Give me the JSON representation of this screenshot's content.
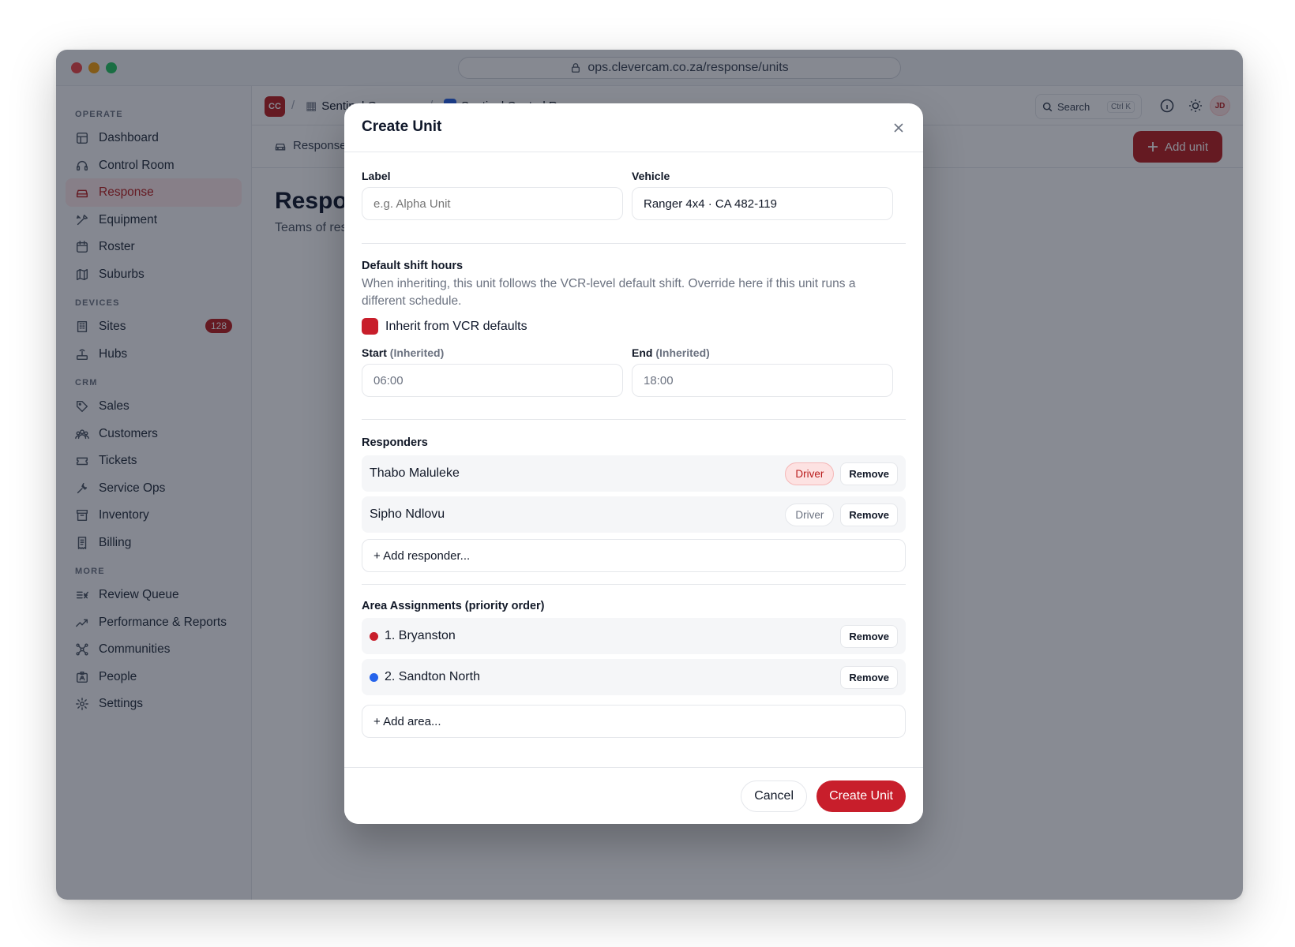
{
  "browser": {
    "url": "ops.clevercam.co.za/response/units"
  },
  "sidebar": {
    "sections": [
      {
        "label": "OPERATE",
        "items": [
          {
            "label": "Dashboard",
            "icon": "dashboard-icon"
          },
          {
            "label": "Control Room",
            "icon": "headset-icon"
          },
          {
            "label": "Response",
            "icon": "car-icon",
            "active": true
          },
          {
            "label": "Equipment",
            "icon": "tools-icon"
          },
          {
            "label": "Roster",
            "icon": "calendar-icon"
          },
          {
            "label": "Suburbs",
            "icon": "map-icon"
          }
        ]
      },
      {
        "label": "DEVICES",
        "items": [
          {
            "label": "Sites",
            "icon": "building-icon",
            "badge": "128"
          },
          {
            "label": "Hubs",
            "icon": "router-icon"
          }
        ]
      },
      {
        "label": "CRM",
        "items": [
          {
            "label": "Sales",
            "icon": "tag-icon"
          },
          {
            "label": "Customers",
            "icon": "users-icon"
          },
          {
            "label": "Tickets",
            "icon": "ticket-icon"
          },
          {
            "label": "Service Ops",
            "icon": "wrench-icon"
          },
          {
            "label": "Inventory",
            "icon": "archive-icon"
          },
          {
            "label": "Billing",
            "icon": "receipt-icon"
          }
        ]
      },
      {
        "label": "MORE",
        "items": [
          {
            "label": "Review Queue",
            "icon": "list-check-icon"
          },
          {
            "label": "Performance & Reports",
            "icon": "chart-line-icon"
          },
          {
            "label": "Communities",
            "icon": "network-icon"
          },
          {
            "label": "People",
            "icon": "id-card-icon"
          },
          {
            "label": "Settings",
            "icon": "gear-icon"
          }
        ]
      }
    ]
  },
  "topbar": {
    "org_initials": "CC",
    "crumb_group": "Sentinel Group",
    "crumb_room": "Sentinel Control Room",
    "search_label": "Search",
    "search_kbd": "Ctrl K",
    "user_initials": "JD"
  },
  "subbar": {
    "tab_label": "Response",
    "add_button": "Add unit"
  },
  "page": {
    "title": "Response",
    "subtitle": "Teams of responders"
  },
  "modal": {
    "title": "Create Unit",
    "label_field": {
      "label": "Label",
      "placeholder": "e.g. Alpha Unit"
    },
    "vehicle_field": {
      "label": "Vehicle",
      "value": "Ranger 4x4 · CA 482-119"
    },
    "shift": {
      "heading": "Default shift hours",
      "hint": "When inheriting, this unit follows the VCR-level default shift. Override here if this unit runs a different schedule.",
      "inherit_label": "Inherit from VCR defaults",
      "start_label": "Start",
      "end_label": "End",
      "inherited_tag": "(Inherited)",
      "start_value": "06:00",
      "end_value": "18:00"
    },
    "responders": {
      "heading": "Responders",
      "items": [
        {
          "name": "Thabo Maluleke",
          "role": "Driver",
          "role_active": true,
          "remove": "Remove"
        },
        {
          "name": "Sipho Ndlovu",
          "role": "Driver",
          "role_active": false,
          "remove": "Remove"
        }
      ],
      "add_label": "+ Add responder..."
    },
    "areas": {
      "heading": "Area Assignments (priority order)",
      "items": [
        {
          "name": "1. Bryanston",
          "color": "#c81e2b",
          "remove": "Remove"
        },
        {
          "name": "2. Sandton North",
          "color": "#2563eb",
          "remove": "Remove"
        }
      ],
      "add_label": "+ Add area..."
    },
    "cancel_label": "Cancel",
    "create_label": "Create Unit"
  }
}
